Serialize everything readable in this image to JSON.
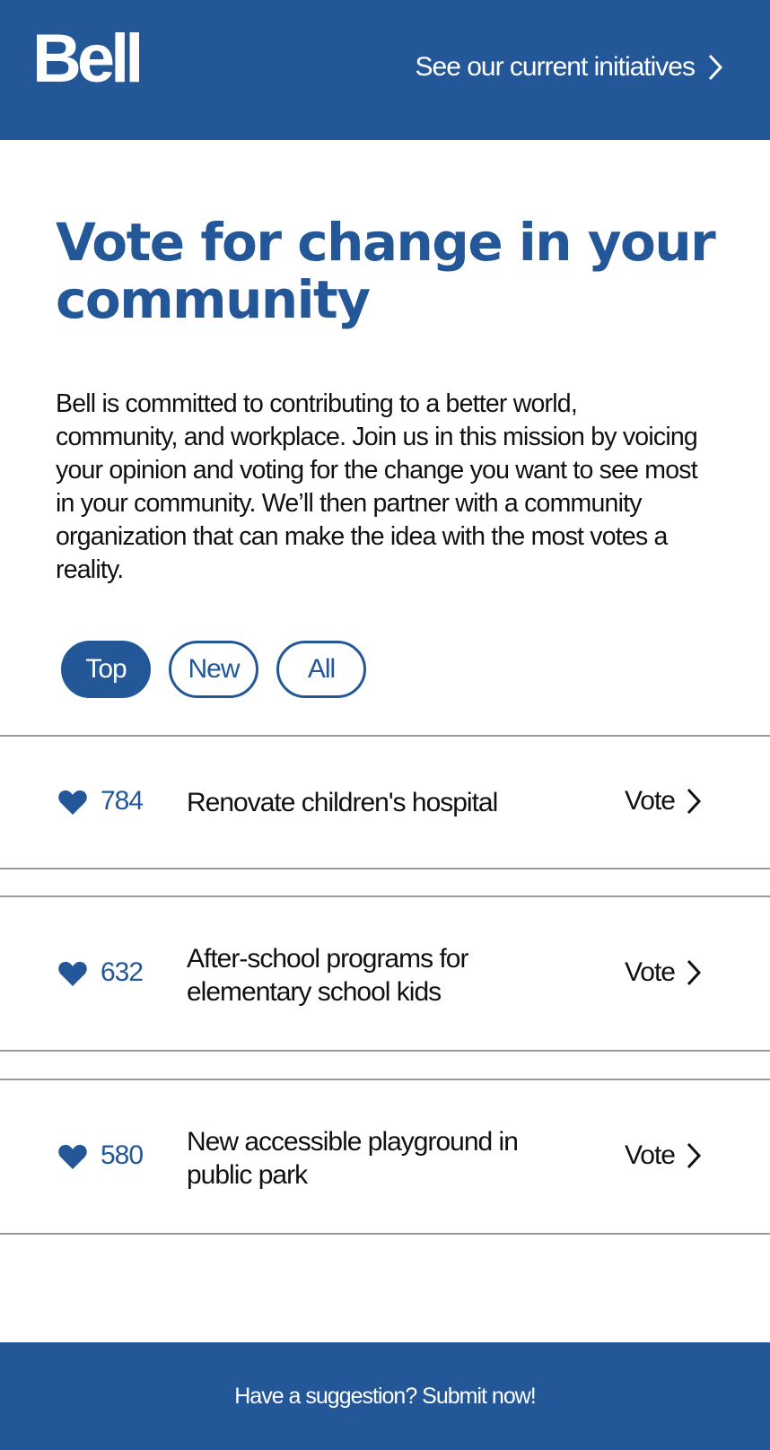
{
  "header": {
    "logo_text": "Bell",
    "initiatives_link": "See our current initiatives"
  },
  "main": {
    "title": "Vote for change in your community",
    "intro": "Bell is committed to contributing to a better world, community, and workplace. Join us in this mission by voicing your opinion and voting for the change you want to see most in your community. We’ll then partner with a community organization that can make the idea with the most votes a reality.",
    "tabs": [
      {
        "label": "Top",
        "active": true
      },
      {
        "label": "New",
        "active": false
      },
      {
        "label": "All",
        "active": false
      }
    ],
    "ideas": [
      {
        "votes": "784",
        "title": "Renovate children's hospital",
        "action": "Vote"
      },
      {
        "votes": "632",
        "title": "After-school programs for elementary school kids",
        "action": "Vote"
      },
      {
        "votes": "580",
        "title": "New accessible playground in public park",
        "action": "Vote"
      }
    ]
  },
  "footer": {
    "cta": "Have a suggestion? Submit now!"
  },
  "icons": {
    "heart": "heart-icon",
    "chevron": "chevron-right-icon"
  },
  "colors": {
    "brand": "#235797",
    "text": "#111111",
    "divider": "#9a9a9a"
  }
}
